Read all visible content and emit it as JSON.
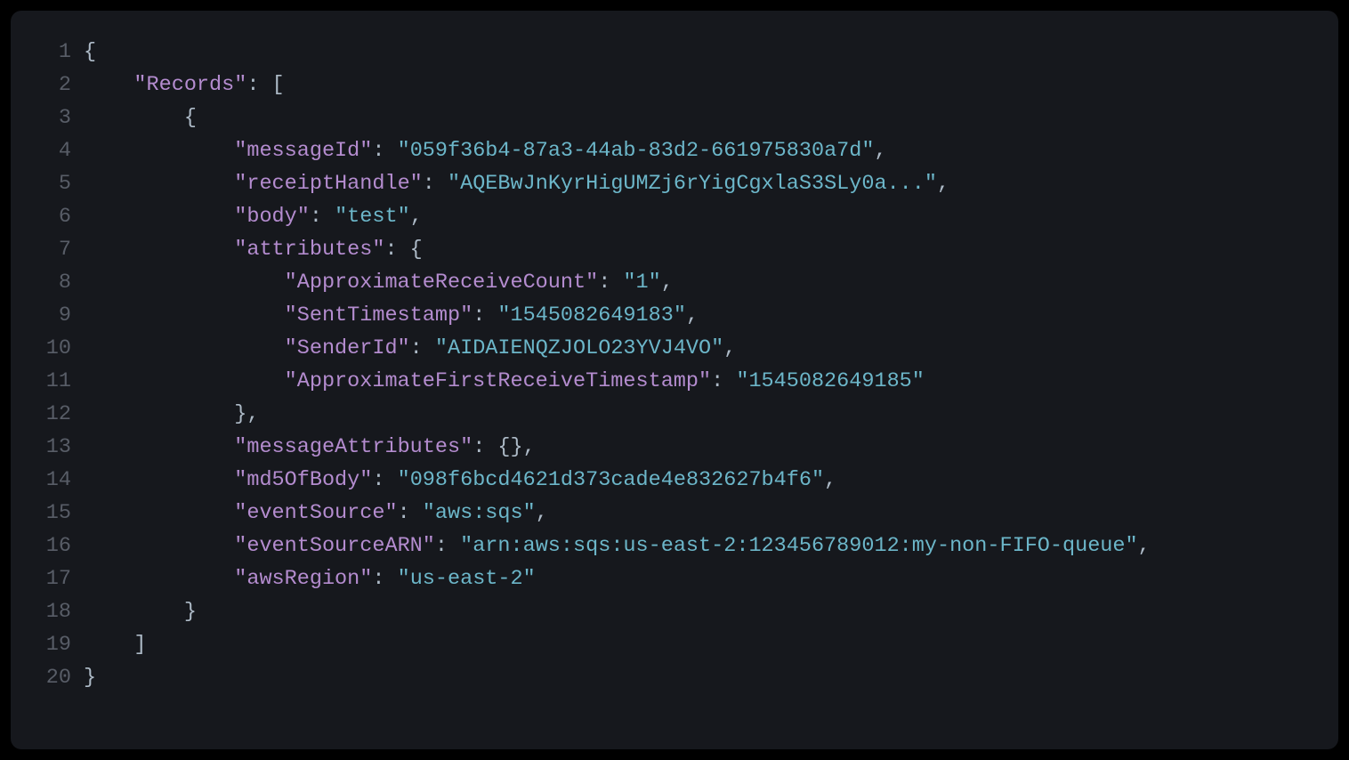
{
  "lines": [
    {
      "num": "1",
      "tokens": [
        {
          "t": "{",
          "c": "brace"
        }
      ]
    },
    {
      "num": "2",
      "tokens": [
        {
          "t": "    ",
          "c": "punct"
        },
        {
          "t": "\"Records\"",
          "c": "key"
        },
        {
          "t": ": [",
          "c": "punct"
        }
      ]
    },
    {
      "num": "3",
      "tokens": [
        {
          "t": "        {",
          "c": "brace"
        }
      ]
    },
    {
      "num": "4",
      "tokens": [
        {
          "t": "            ",
          "c": "punct"
        },
        {
          "t": "\"messageId\"",
          "c": "key"
        },
        {
          "t": ": ",
          "c": "punct"
        },
        {
          "t": "\"059f36b4-87a3-44ab-83d2-661975830a7d\"",
          "c": "str"
        },
        {
          "t": ",",
          "c": "punct"
        }
      ]
    },
    {
      "num": "5",
      "tokens": [
        {
          "t": "            ",
          "c": "punct"
        },
        {
          "t": "\"receiptHandle\"",
          "c": "key"
        },
        {
          "t": ": ",
          "c": "punct"
        },
        {
          "t": "\"AQEBwJnKyrHigUMZj6rYigCgxlaS3SLy0a...\"",
          "c": "str"
        },
        {
          "t": ",",
          "c": "punct"
        }
      ]
    },
    {
      "num": "6",
      "tokens": [
        {
          "t": "            ",
          "c": "punct"
        },
        {
          "t": "\"body\"",
          "c": "key"
        },
        {
          "t": ": ",
          "c": "punct"
        },
        {
          "t": "\"test\"",
          "c": "str"
        },
        {
          "t": ",",
          "c": "punct"
        }
      ]
    },
    {
      "num": "7",
      "tokens": [
        {
          "t": "            ",
          "c": "punct"
        },
        {
          "t": "\"attributes\"",
          "c": "key"
        },
        {
          "t": ": {",
          "c": "punct"
        }
      ]
    },
    {
      "num": "8",
      "tokens": [
        {
          "t": "                ",
          "c": "punct"
        },
        {
          "t": "\"ApproximateReceiveCount\"",
          "c": "key"
        },
        {
          "t": ": ",
          "c": "punct"
        },
        {
          "t": "\"1\"",
          "c": "str"
        },
        {
          "t": ",",
          "c": "punct"
        }
      ]
    },
    {
      "num": "9",
      "tokens": [
        {
          "t": "                ",
          "c": "punct"
        },
        {
          "t": "\"SentTimestamp\"",
          "c": "key"
        },
        {
          "t": ": ",
          "c": "punct"
        },
        {
          "t": "\"1545082649183\"",
          "c": "str"
        },
        {
          "t": ",",
          "c": "punct"
        }
      ]
    },
    {
      "num": "10",
      "tokens": [
        {
          "t": "                ",
          "c": "punct"
        },
        {
          "t": "\"SenderId\"",
          "c": "key"
        },
        {
          "t": ": ",
          "c": "punct"
        },
        {
          "t": "\"AIDAIENQZJOLO23YVJ4VO\"",
          "c": "str"
        },
        {
          "t": ",",
          "c": "punct"
        }
      ]
    },
    {
      "num": "11",
      "tokens": [
        {
          "t": "                ",
          "c": "punct"
        },
        {
          "t": "\"ApproximateFirstReceiveTimestamp\"",
          "c": "key"
        },
        {
          "t": ": ",
          "c": "punct"
        },
        {
          "t": "\"1545082649185\"",
          "c": "str"
        }
      ]
    },
    {
      "num": "12",
      "tokens": [
        {
          "t": "            },",
          "c": "brace"
        }
      ]
    },
    {
      "num": "13",
      "tokens": [
        {
          "t": "            ",
          "c": "punct"
        },
        {
          "t": "\"messageAttributes\"",
          "c": "key"
        },
        {
          "t": ": {},",
          "c": "punct"
        }
      ]
    },
    {
      "num": "14",
      "tokens": [
        {
          "t": "            ",
          "c": "punct"
        },
        {
          "t": "\"md5OfBody\"",
          "c": "key"
        },
        {
          "t": ": ",
          "c": "punct"
        },
        {
          "t": "\"098f6bcd4621d373cade4e832627b4f6\"",
          "c": "str"
        },
        {
          "t": ",",
          "c": "punct"
        }
      ]
    },
    {
      "num": "15",
      "tokens": [
        {
          "t": "            ",
          "c": "punct"
        },
        {
          "t": "\"eventSource\"",
          "c": "key"
        },
        {
          "t": ": ",
          "c": "punct"
        },
        {
          "t": "\"aws:sqs\"",
          "c": "str"
        },
        {
          "t": ",",
          "c": "punct"
        }
      ]
    },
    {
      "num": "16",
      "tokens": [
        {
          "t": "            ",
          "c": "punct"
        },
        {
          "t": "\"eventSourceARN\"",
          "c": "key"
        },
        {
          "t": ": ",
          "c": "punct"
        },
        {
          "t": "\"arn:aws:sqs:us-east-2:123456789012:my-non-FIFO-queue\"",
          "c": "str"
        },
        {
          "t": ",",
          "c": "punct"
        }
      ]
    },
    {
      "num": "17",
      "tokens": [
        {
          "t": "            ",
          "c": "punct"
        },
        {
          "t": "\"awsRegion\"",
          "c": "key"
        },
        {
          "t": ": ",
          "c": "punct"
        },
        {
          "t": "\"us-east-2\"",
          "c": "str"
        }
      ]
    },
    {
      "num": "18",
      "tokens": [
        {
          "t": "        }",
          "c": "brace"
        }
      ]
    },
    {
      "num": "19",
      "tokens": [
        {
          "t": "    ]",
          "c": "brace"
        }
      ]
    },
    {
      "num": "20",
      "tokens": [
        {
          "t": "}",
          "c": "brace"
        }
      ]
    }
  ]
}
